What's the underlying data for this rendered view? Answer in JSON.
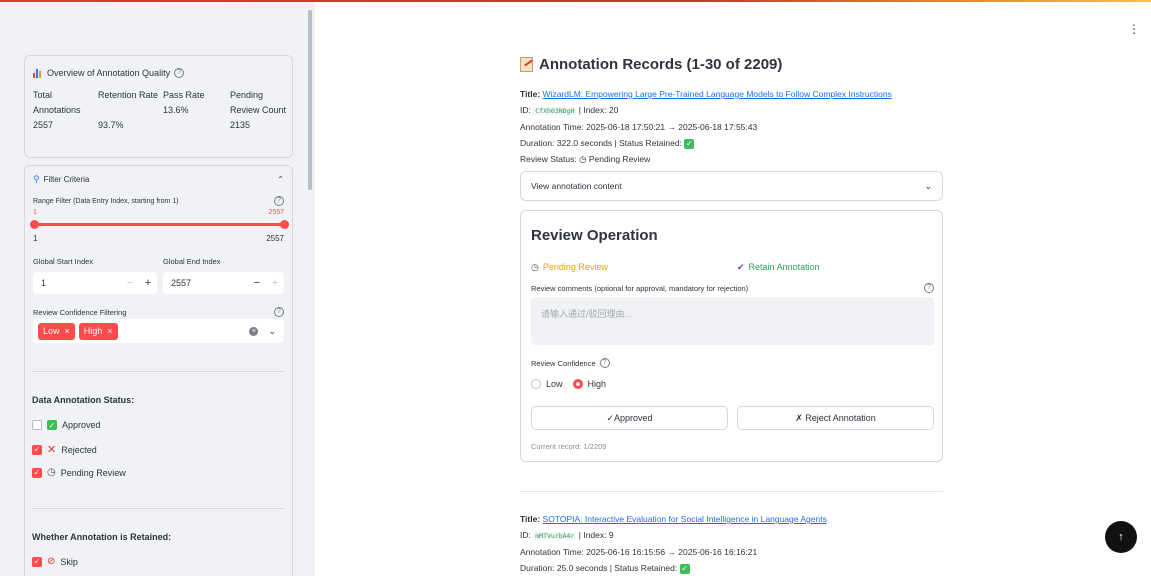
{
  "sidebar": {
    "overview": {
      "title": "Overview of Annotation Quality",
      "help_icon": "question-circle-icon",
      "stats": [
        {
          "label": "Total Annotations",
          "value": "2557"
        },
        {
          "label": "Retention Rate",
          "value": "93.7%"
        },
        {
          "label": "Pass Rate",
          "value": "13.6%"
        },
        {
          "label": "Pending Review Count",
          "value": "2135"
        }
      ]
    },
    "filter": {
      "title": "Filter Criteria",
      "range_label": "Range Filter (Data Entry Index, starting from 1)",
      "range_min_marker": "1",
      "range_max_marker": "2557",
      "range_min": "1",
      "range_max": "2557",
      "start_label": "Global Start Index",
      "start_value": "1",
      "end_label": "Global End Index",
      "end_value": "2557",
      "confidence_label": "Review Confidence Filtering",
      "confidence_tags": [
        "Low",
        "High"
      ]
    },
    "status": {
      "title": "Data Annotation Status:",
      "options": [
        {
          "label": "Approved",
          "checked": false
        },
        {
          "label": "Rejected",
          "checked": true
        },
        {
          "label": "Pending Review",
          "checked": true
        }
      ]
    },
    "retained": {
      "title": "Whether Annotation is Retained:",
      "options": [
        {
          "label": "Skip",
          "checked": true
        }
      ]
    }
  },
  "main": {
    "heading": "Annotation Records (1-30 of 2209)",
    "records": [
      {
        "title_label": "Title:",
        "title": "WizardLM: Empowering Large Pre-Trained Language Models to Follow Complex Instructions",
        "id_label": "ID:",
        "id": "CfXh03NDgH",
        "index": "| Index: 20",
        "time": "Annotation Time: 2025-06-18 17:50:21 → 2025-06-18 17:55:43",
        "duration": "Duration: 322.0 seconds | Status Retained:",
        "review_status": "Review Status:",
        "review_status_value": "Pending Review"
      },
      {
        "title_label": "Title:",
        "title": "SOTOPIA: Interactive Evaluation for Social Intelligence in Language Agents",
        "id_label": "ID:",
        "id": "mMTVurbA4r",
        "index": "| Index: 9",
        "time": "Annotation Time: 2025-06-16 16:15:56 → 2025-06-16 16:16:21",
        "duration": "Duration: 25.0 seconds | Status Retained:"
      }
    ],
    "expander_label": "View annotation content",
    "review": {
      "title": "Review Operation",
      "pending_label": "Pending Review",
      "retain_label": "Retain Annotation",
      "comment_label": "Review comments (optional for approval, mandatory for rejection)",
      "comment_placeholder": "请输入通过/驳回理由...",
      "confidence_label": "Review Confidence",
      "confidence_options": [
        "Low",
        "High"
      ],
      "confidence_selected": "High",
      "approve_label": "✓Approved",
      "reject_label": "✗ Reject Annotation",
      "current_record": "Current record: 1/2209"
    }
  },
  "colors": {
    "accent": "#ff4b4b",
    "link": "#1c6ff0",
    "pending": "#e0a800",
    "retain": "#2e9e55"
  }
}
